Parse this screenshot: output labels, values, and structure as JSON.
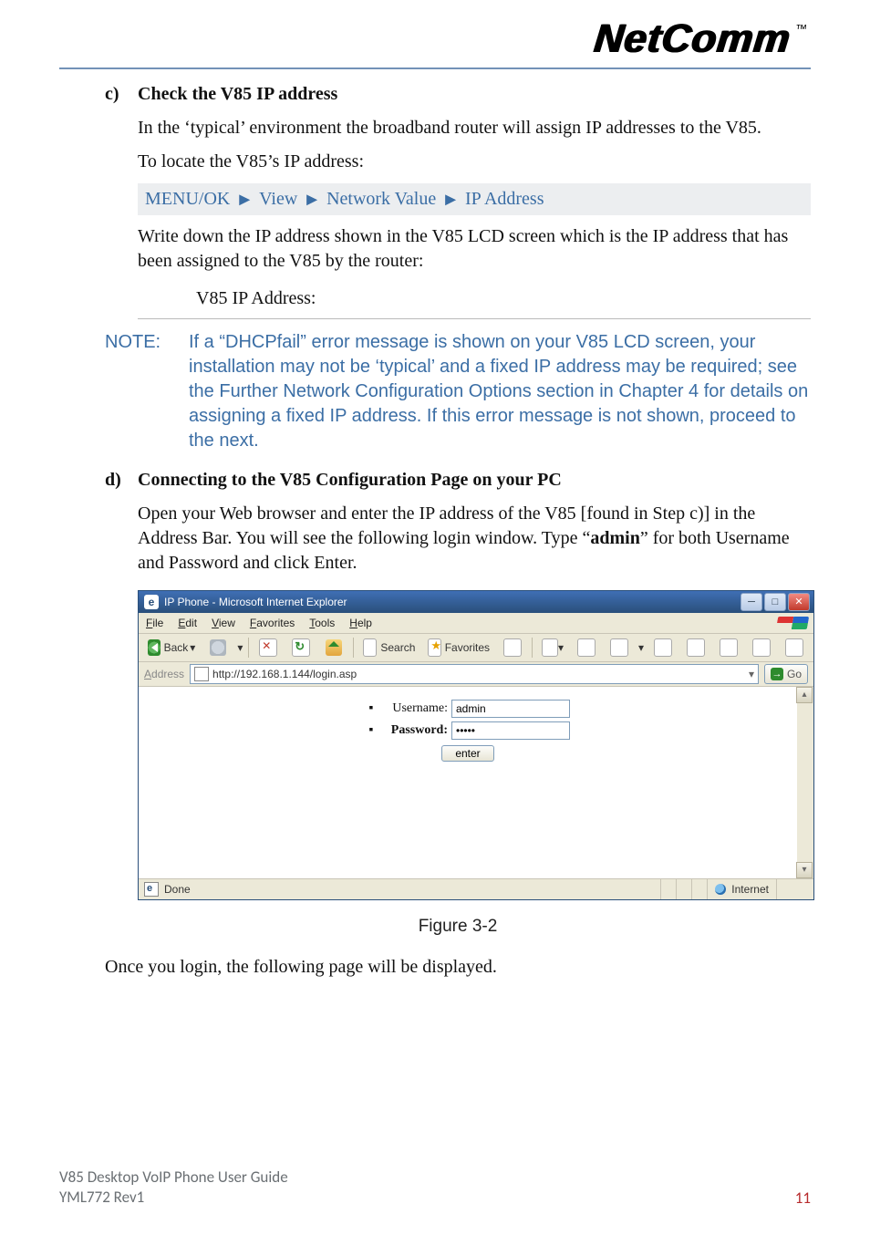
{
  "logo": {
    "text": "NetComm",
    "trademark": "™"
  },
  "section_c": {
    "letter": "c)",
    "title": "Check the V85 IP address",
    "para1": "In the ‘typical’ environment the broadband router will assign IP addresses to the V85.",
    "para2": "To locate the V85’s IP address:",
    "menu_path": [
      "MENU/OK",
      "View",
      "Network Value",
      "IP Address"
    ],
    "arrow_glyph": "►",
    "para3": "Write down the IP address shown in the V85 LCD screen which is the IP address that has been assigned to the V85 by the router:",
    "ip_label": "V85 IP Address:"
  },
  "note": {
    "label": "NOTE:",
    "text": "If a “DHCPfail” error message is shown on your V85 LCD screen, your installation may not be ‘typical’ and a fixed IP address may be required; see the Further Network Configuration Options section in Chapter 4 for details on assigning a fixed IP address.  If this error message is not shown, proceed to the next."
  },
  "section_d": {
    "letter": "d)",
    "title": "Connecting to the V85 Configuration Page on your PC",
    "para_pre": "Open your Web browser and enter the IP address of the V85 [found in Step c)] in the Address Bar.  You will see the following login window. Type “",
    "para_bold": "admin",
    "para_post": "” for both Username and Password and click Enter."
  },
  "ie": {
    "title": "IP Phone - Microsoft Internet Explorer",
    "menus": [
      "File",
      "Edit",
      "View",
      "Favorites",
      "Tools",
      "Help"
    ],
    "back": "Back",
    "search": "Search",
    "favorites": "Favorites",
    "address_label": "Address",
    "url": "http://192.168.1.144/login.asp",
    "go": "Go",
    "username_label": "Username:",
    "password_label": "Password:",
    "username_value": "admin",
    "password_value": "•••••",
    "enter_button": "enter",
    "status_done": "Done",
    "status_zone": "Internet"
  },
  "figure_caption": "Figure 3-2",
  "after_login_text": "Once you login, the following page will be displayed.",
  "footer": {
    "line1": "V85 Desktop VoIP Phone User Guide",
    "line2": "YML772 Rev1",
    "page_number": "11"
  }
}
